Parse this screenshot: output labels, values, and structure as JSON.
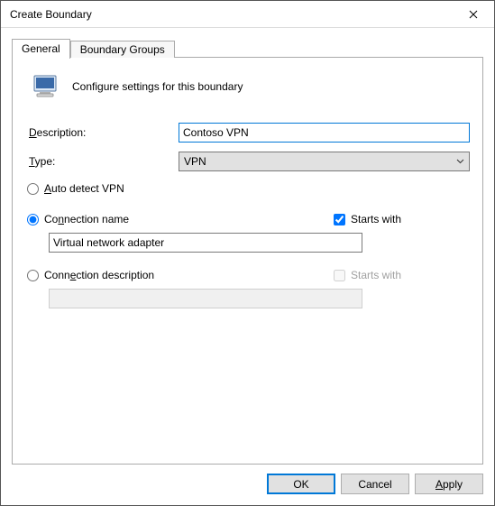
{
  "window": {
    "title": "Create Boundary"
  },
  "tabs": {
    "general": "General",
    "groups": "Boundary Groups"
  },
  "intro": {
    "text": "Configure settings for this boundary"
  },
  "fields": {
    "description_label": "Description:",
    "description_value": "Contoso VPN",
    "type_label": "Type:",
    "type_value": "VPN"
  },
  "options": {
    "auto_detect": "Auto detect VPN",
    "connection_name": "Connection name",
    "connection_name_value": "Virtual network adapter",
    "starts_with": "Starts with",
    "connection_description": "Connection description",
    "connection_description_value": ""
  },
  "buttons": {
    "ok": "OK",
    "cancel": "Cancel",
    "apply": "Apply"
  }
}
